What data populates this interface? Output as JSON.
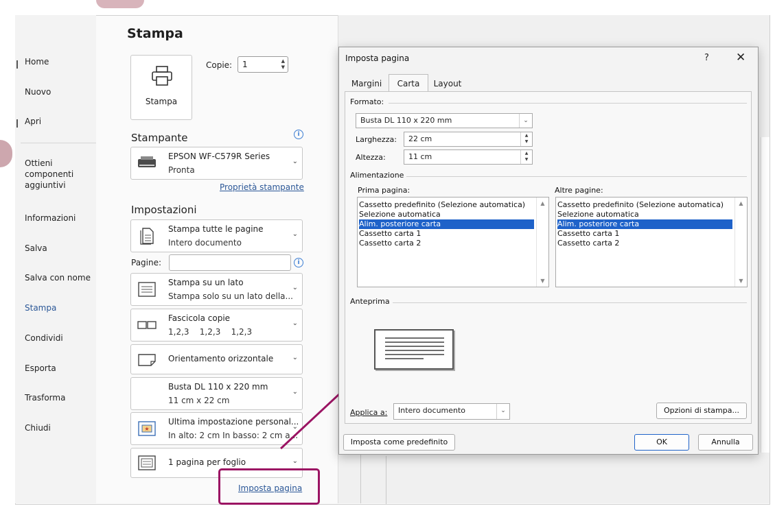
{
  "nav": {
    "items": [
      "Home",
      "Nuovo",
      "Apri",
      "Ottieni componenti aggiuntivi",
      "Informazioni",
      "Salva",
      "Salva con nome",
      "Stampa",
      "Condividi",
      "Esporta",
      "Trasforma",
      "Chiudi"
    ],
    "active": "Stampa"
  },
  "print": {
    "title": "Stampa",
    "print_button": "Stampa",
    "copies_label": "Copie:",
    "copies_value": "1",
    "printer_section": "Stampante",
    "printer_name": "EPSON WF-C579R Series",
    "printer_status": "Pronta",
    "printer_props_link": "Proprietà stampante",
    "settings_section": "Impostazioni",
    "pages_label": "Pagine:",
    "pages_value": "",
    "settings": [
      {
        "line1": "Stampa tutte le pagine",
        "line2": "Intero documento",
        "icon": "pages-icon"
      },
      {
        "line1": "Stampa su un lato",
        "line2": "Stampa solo su un lato della...",
        "icon": "one-side-icon"
      },
      {
        "line1": "Fascicola copie",
        "line2": "1,2,3    1,2,3    1,2,3",
        "icon": "collate-icon"
      },
      {
        "line1": "Orientamento orizzontale",
        "line2": "",
        "icon": "landscape-icon"
      },
      {
        "line1": "Busta DL 110 x 220 mm",
        "line2": "11 cm x 22 cm",
        "icon": "envelope-icon"
      },
      {
        "line1": "Ultima impostazione personal...",
        "line2": "In alto: 2 cm In basso: 2 cm a...",
        "icon": "margins-icon"
      },
      {
        "line1": "1 pagina per foglio",
        "line2": "",
        "icon": "pages-per-sheet-icon"
      }
    ],
    "page_setup_link": "Imposta pagina"
  },
  "dialog": {
    "title": "Imposta pagina",
    "help": "?",
    "close": "✕",
    "tabs": [
      "Margini",
      "Carta",
      "Layout"
    ],
    "active_tab": "Carta",
    "format_group": "Formato:",
    "format_value": "Busta DL 110 x 220 mm",
    "width_label": "Larghezza:",
    "width_value": "22 cm",
    "height_label": "Altezza:",
    "height_value": "11 cm",
    "feed_group": "Alimentazione",
    "first_page_label": "Prima pagina:",
    "other_pages_label": "Altre pagine:",
    "first_page_items": [
      "Cassetto predefinito (Selezione automatica)",
      "Selezione automatica",
      "Alim. posteriore carta",
      "Cassetto carta 1",
      "Cassetto carta 2"
    ],
    "other_pages_items": [
      "Cassetto predefinito (Selezione automatica)",
      "Selezione automatica",
      "Alim. posteriore carta",
      "Cassetto carta 1",
      "Cassetto carta 2"
    ],
    "first_page_selected": "Alim. posteriore carta",
    "other_pages_selected": "Alim. posteriore carta",
    "preview_group": "Anteprima",
    "apply_label": "Applica a:",
    "apply_value": "Intero documento",
    "print_options_button": "Opzioni di stampa...",
    "set_default_button": "Imposta come predefinito",
    "ok_button": "OK",
    "cancel_button": "Annulla"
  },
  "colors": {
    "highlight": "#9b1463",
    "selection": "#1e62c9",
    "link": "#2b5797"
  }
}
